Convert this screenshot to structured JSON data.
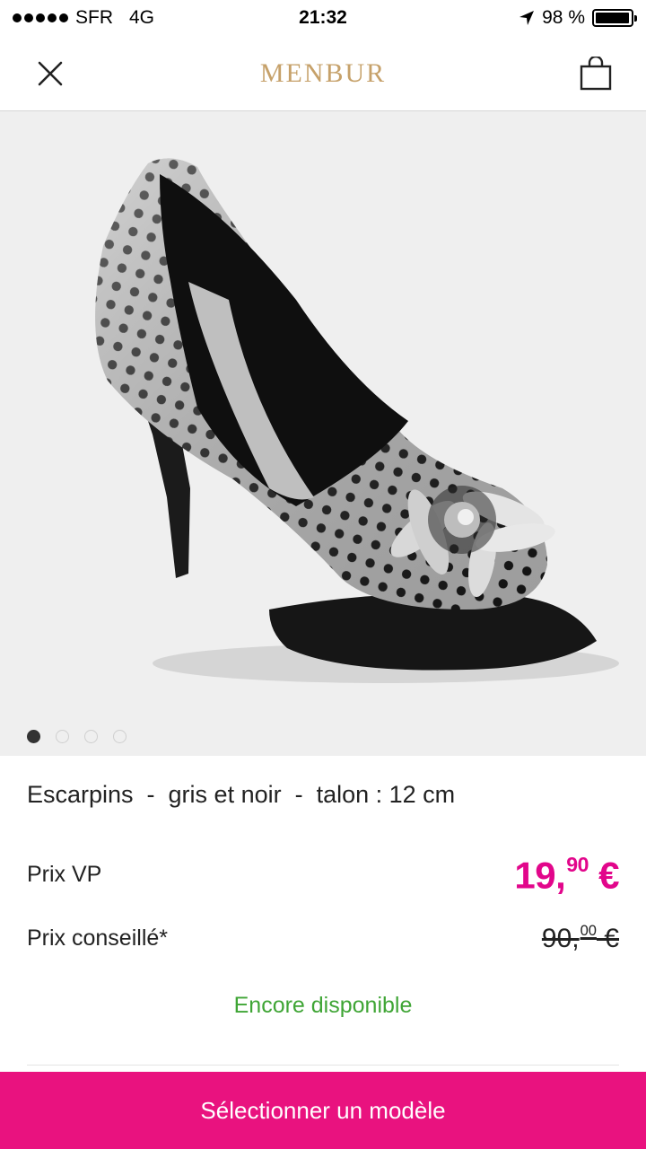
{
  "status_bar": {
    "carrier": "SFR",
    "network": "4G",
    "time": "21:32",
    "battery_percent": "98 %",
    "battery_level": 0.98
  },
  "header": {
    "brand": "MENBUR",
    "close_icon": "close-icon",
    "cart_icon": "shopping-bag-icon"
  },
  "gallery": {
    "image_count": 4,
    "active_index": 0
  },
  "product": {
    "title": "Escarpins  -  gris et noir  -  talon : 12 cm",
    "price_vp_label": "Prix VP",
    "price_vp_int": "19,",
    "price_vp_dec": "90",
    "price_vp_cur": " €",
    "price_old_label": "Prix conseillé*",
    "price_old_int": "90,",
    "price_old_dec": "00",
    "price_old_cur": " €",
    "availability": "Encore disponible"
  },
  "cta": {
    "label": "Sélectionner un modèle"
  },
  "colors": {
    "accent": "#e9127f",
    "price": "#e2068b",
    "available": "#3fa535",
    "brand": "#c6a16a"
  }
}
